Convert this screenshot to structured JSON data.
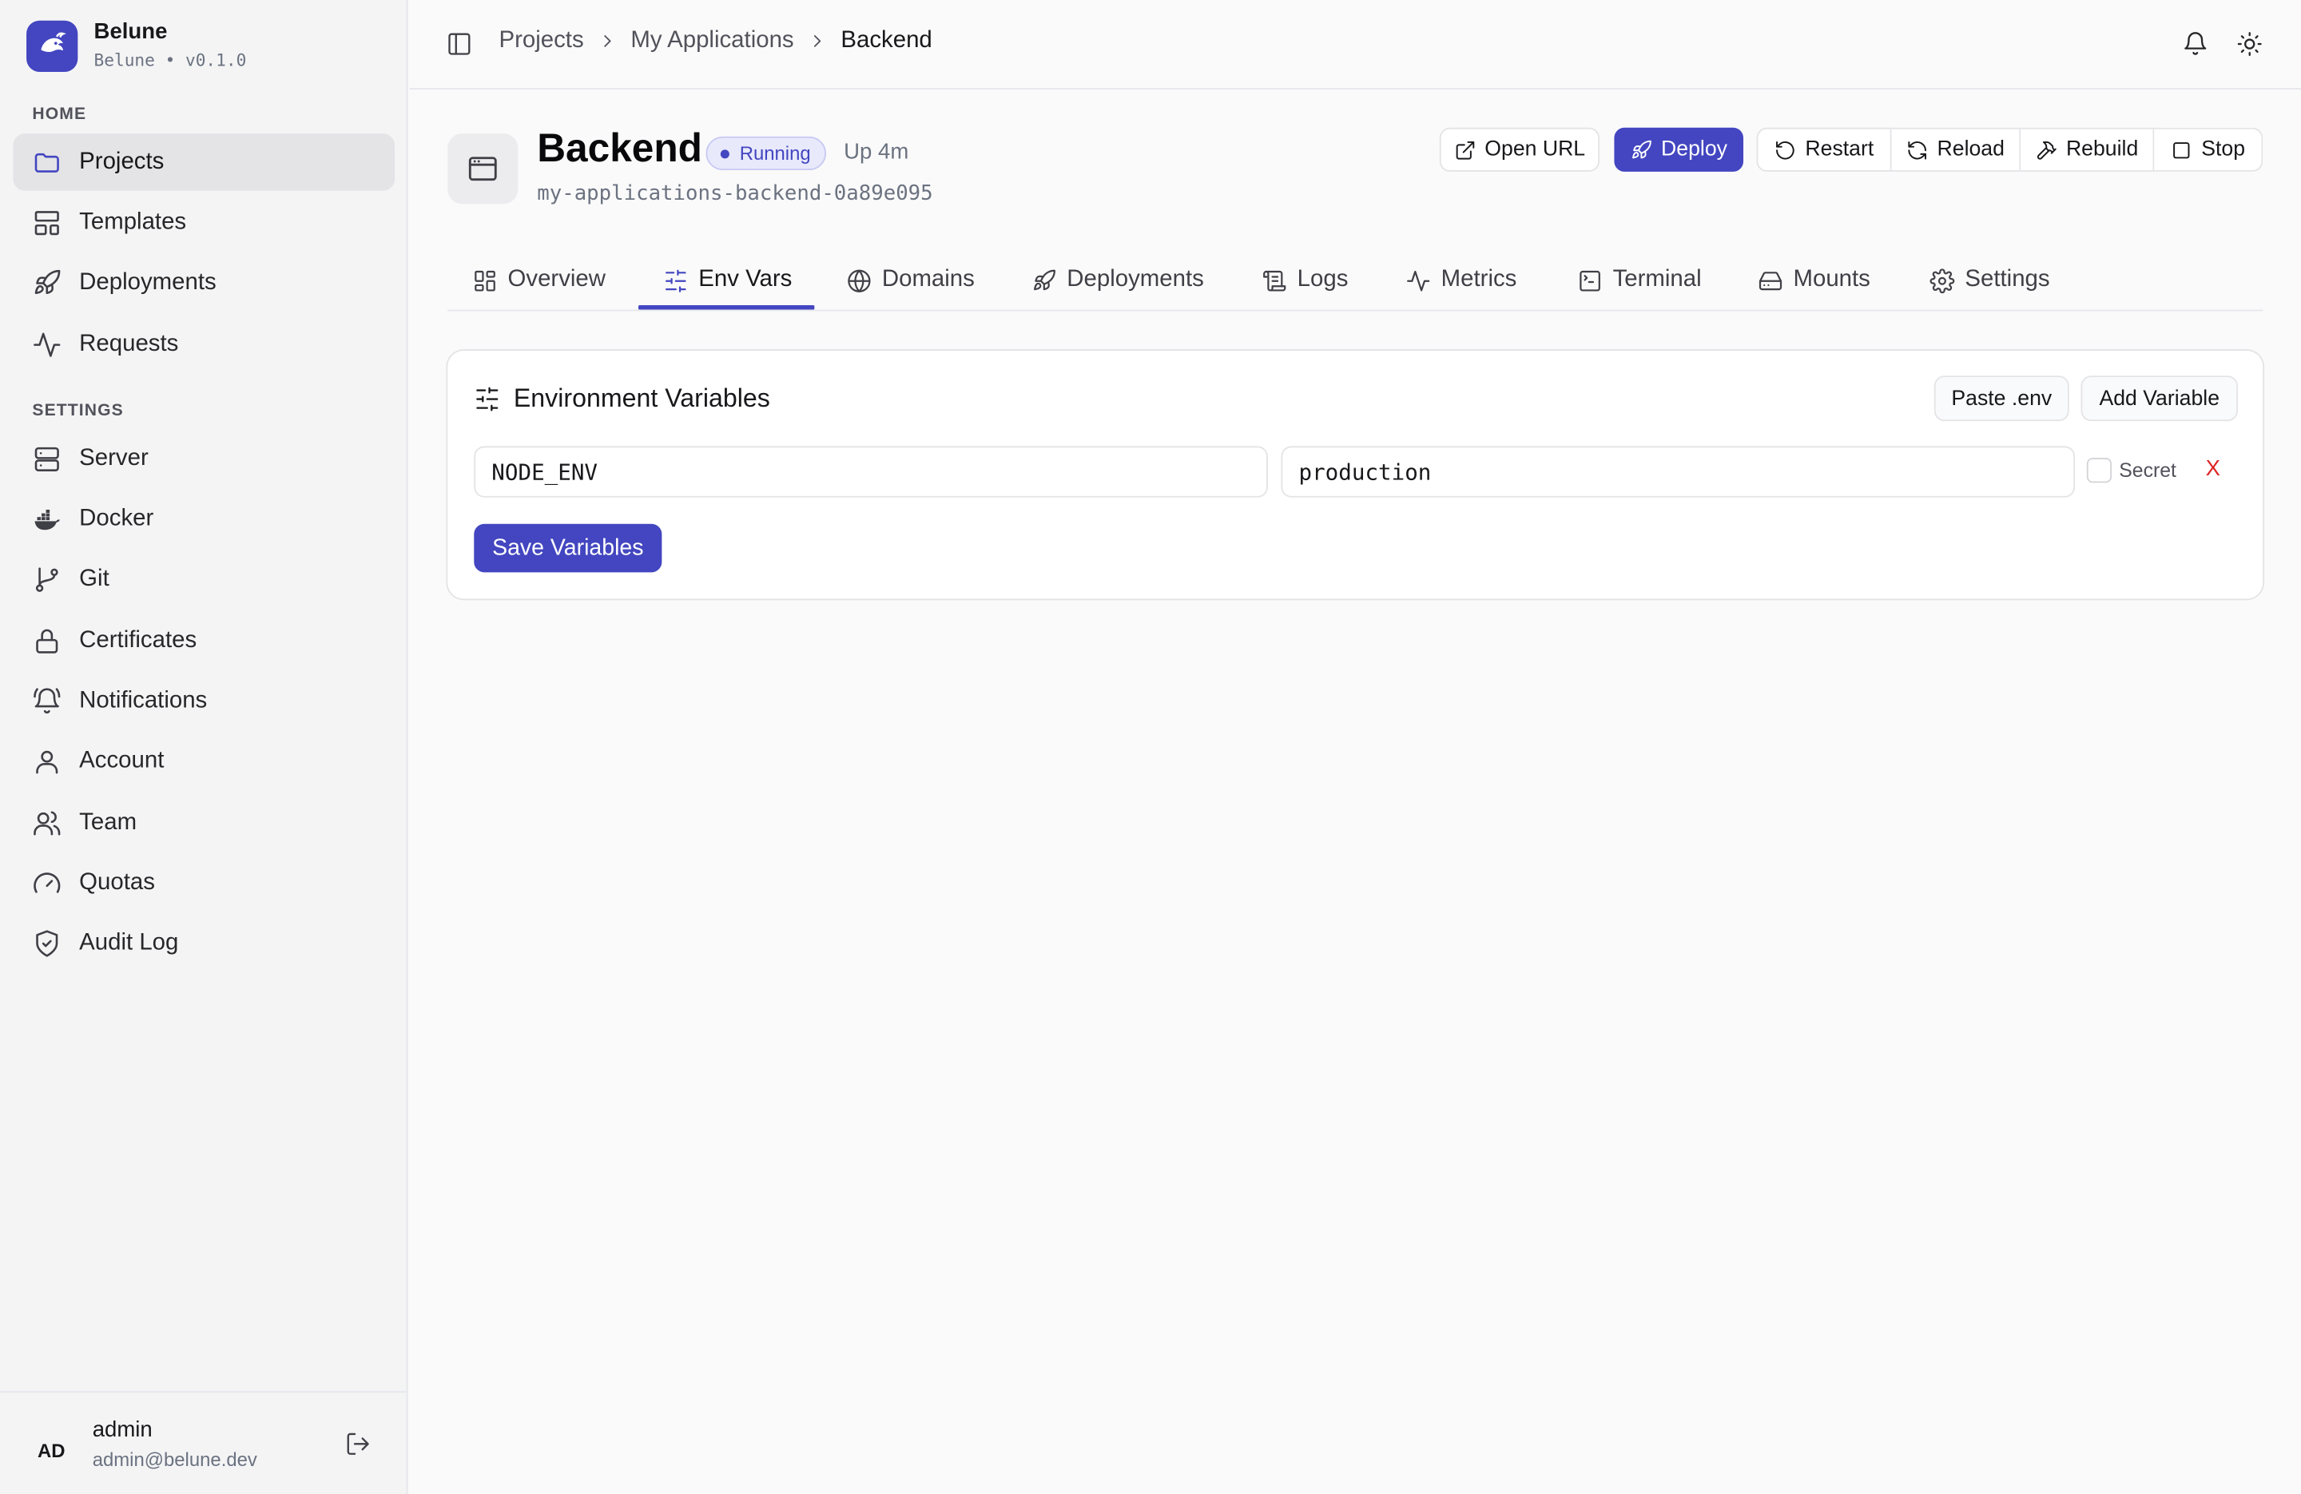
{
  "brand": {
    "name": "Belune",
    "subtitle": "Belune • v0.1.0"
  },
  "sidebar": {
    "home_label": "HOME",
    "home_items": [
      {
        "label": "Projects",
        "icon": "folder-icon"
      },
      {
        "label": "Templates",
        "icon": "templates-icon"
      },
      {
        "label": "Deployments",
        "icon": "rocket-icon"
      },
      {
        "label": "Requests",
        "icon": "activity-icon"
      }
    ],
    "settings_label": "SETTINGS",
    "settings_items": [
      {
        "label": "Server",
        "icon": "server-icon"
      },
      {
        "label": "Docker",
        "icon": "docker-icon"
      },
      {
        "label": "Git",
        "icon": "git-branch-icon"
      },
      {
        "label": "Certificates",
        "icon": "lock-icon"
      },
      {
        "label": "Notifications",
        "icon": "bell-ring-icon"
      },
      {
        "label": "Account",
        "icon": "user-icon"
      },
      {
        "label": "Team",
        "icon": "users-icon"
      },
      {
        "label": "Quotas",
        "icon": "gauge-icon"
      },
      {
        "label": "Audit Log",
        "icon": "shield-check-icon"
      }
    ],
    "active": "Projects"
  },
  "user": {
    "initials": "AD",
    "name": "admin",
    "email": "admin@belune.dev"
  },
  "breadcrumbs": [
    "Projects",
    "My Applications",
    "Backend"
  ],
  "app": {
    "name": "Backend",
    "status": "Running",
    "uptime": "Up 4m",
    "slug": "my-applications-backend-0a89e095"
  },
  "actions": {
    "open_url": "Open URL",
    "deploy": "Deploy",
    "restart": "Restart",
    "reload": "Reload",
    "rebuild": "Rebuild",
    "stop": "Stop"
  },
  "tabs": [
    {
      "label": "Overview",
      "icon": "layout-grid-icon"
    },
    {
      "label": "Env Vars",
      "icon": "sliders-icon"
    },
    {
      "label": "Domains",
      "icon": "globe-icon"
    },
    {
      "label": "Deployments",
      "icon": "rocket-icon"
    },
    {
      "label": "Logs",
      "icon": "scroll-icon"
    },
    {
      "label": "Metrics",
      "icon": "activity-icon"
    },
    {
      "label": "Terminal",
      "icon": "terminal-icon"
    },
    {
      "label": "Mounts",
      "icon": "hard-drive-icon"
    },
    {
      "label": "Settings",
      "icon": "gear-icon"
    }
  ],
  "active_tab": "Env Vars",
  "env": {
    "title": "Environment Variables",
    "paste_label": "Paste .env",
    "add_label": "Add Variable",
    "variables": [
      {
        "key": "NODE_ENV",
        "value": "production",
        "secret": false
      }
    ],
    "secret_label": "Secret",
    "remove_label": "X",
    "save_label": "Save Variables"
  },
  "colors": {
    "accent": "#4346c0",
    "danger": "#dc2626"
  }
}
